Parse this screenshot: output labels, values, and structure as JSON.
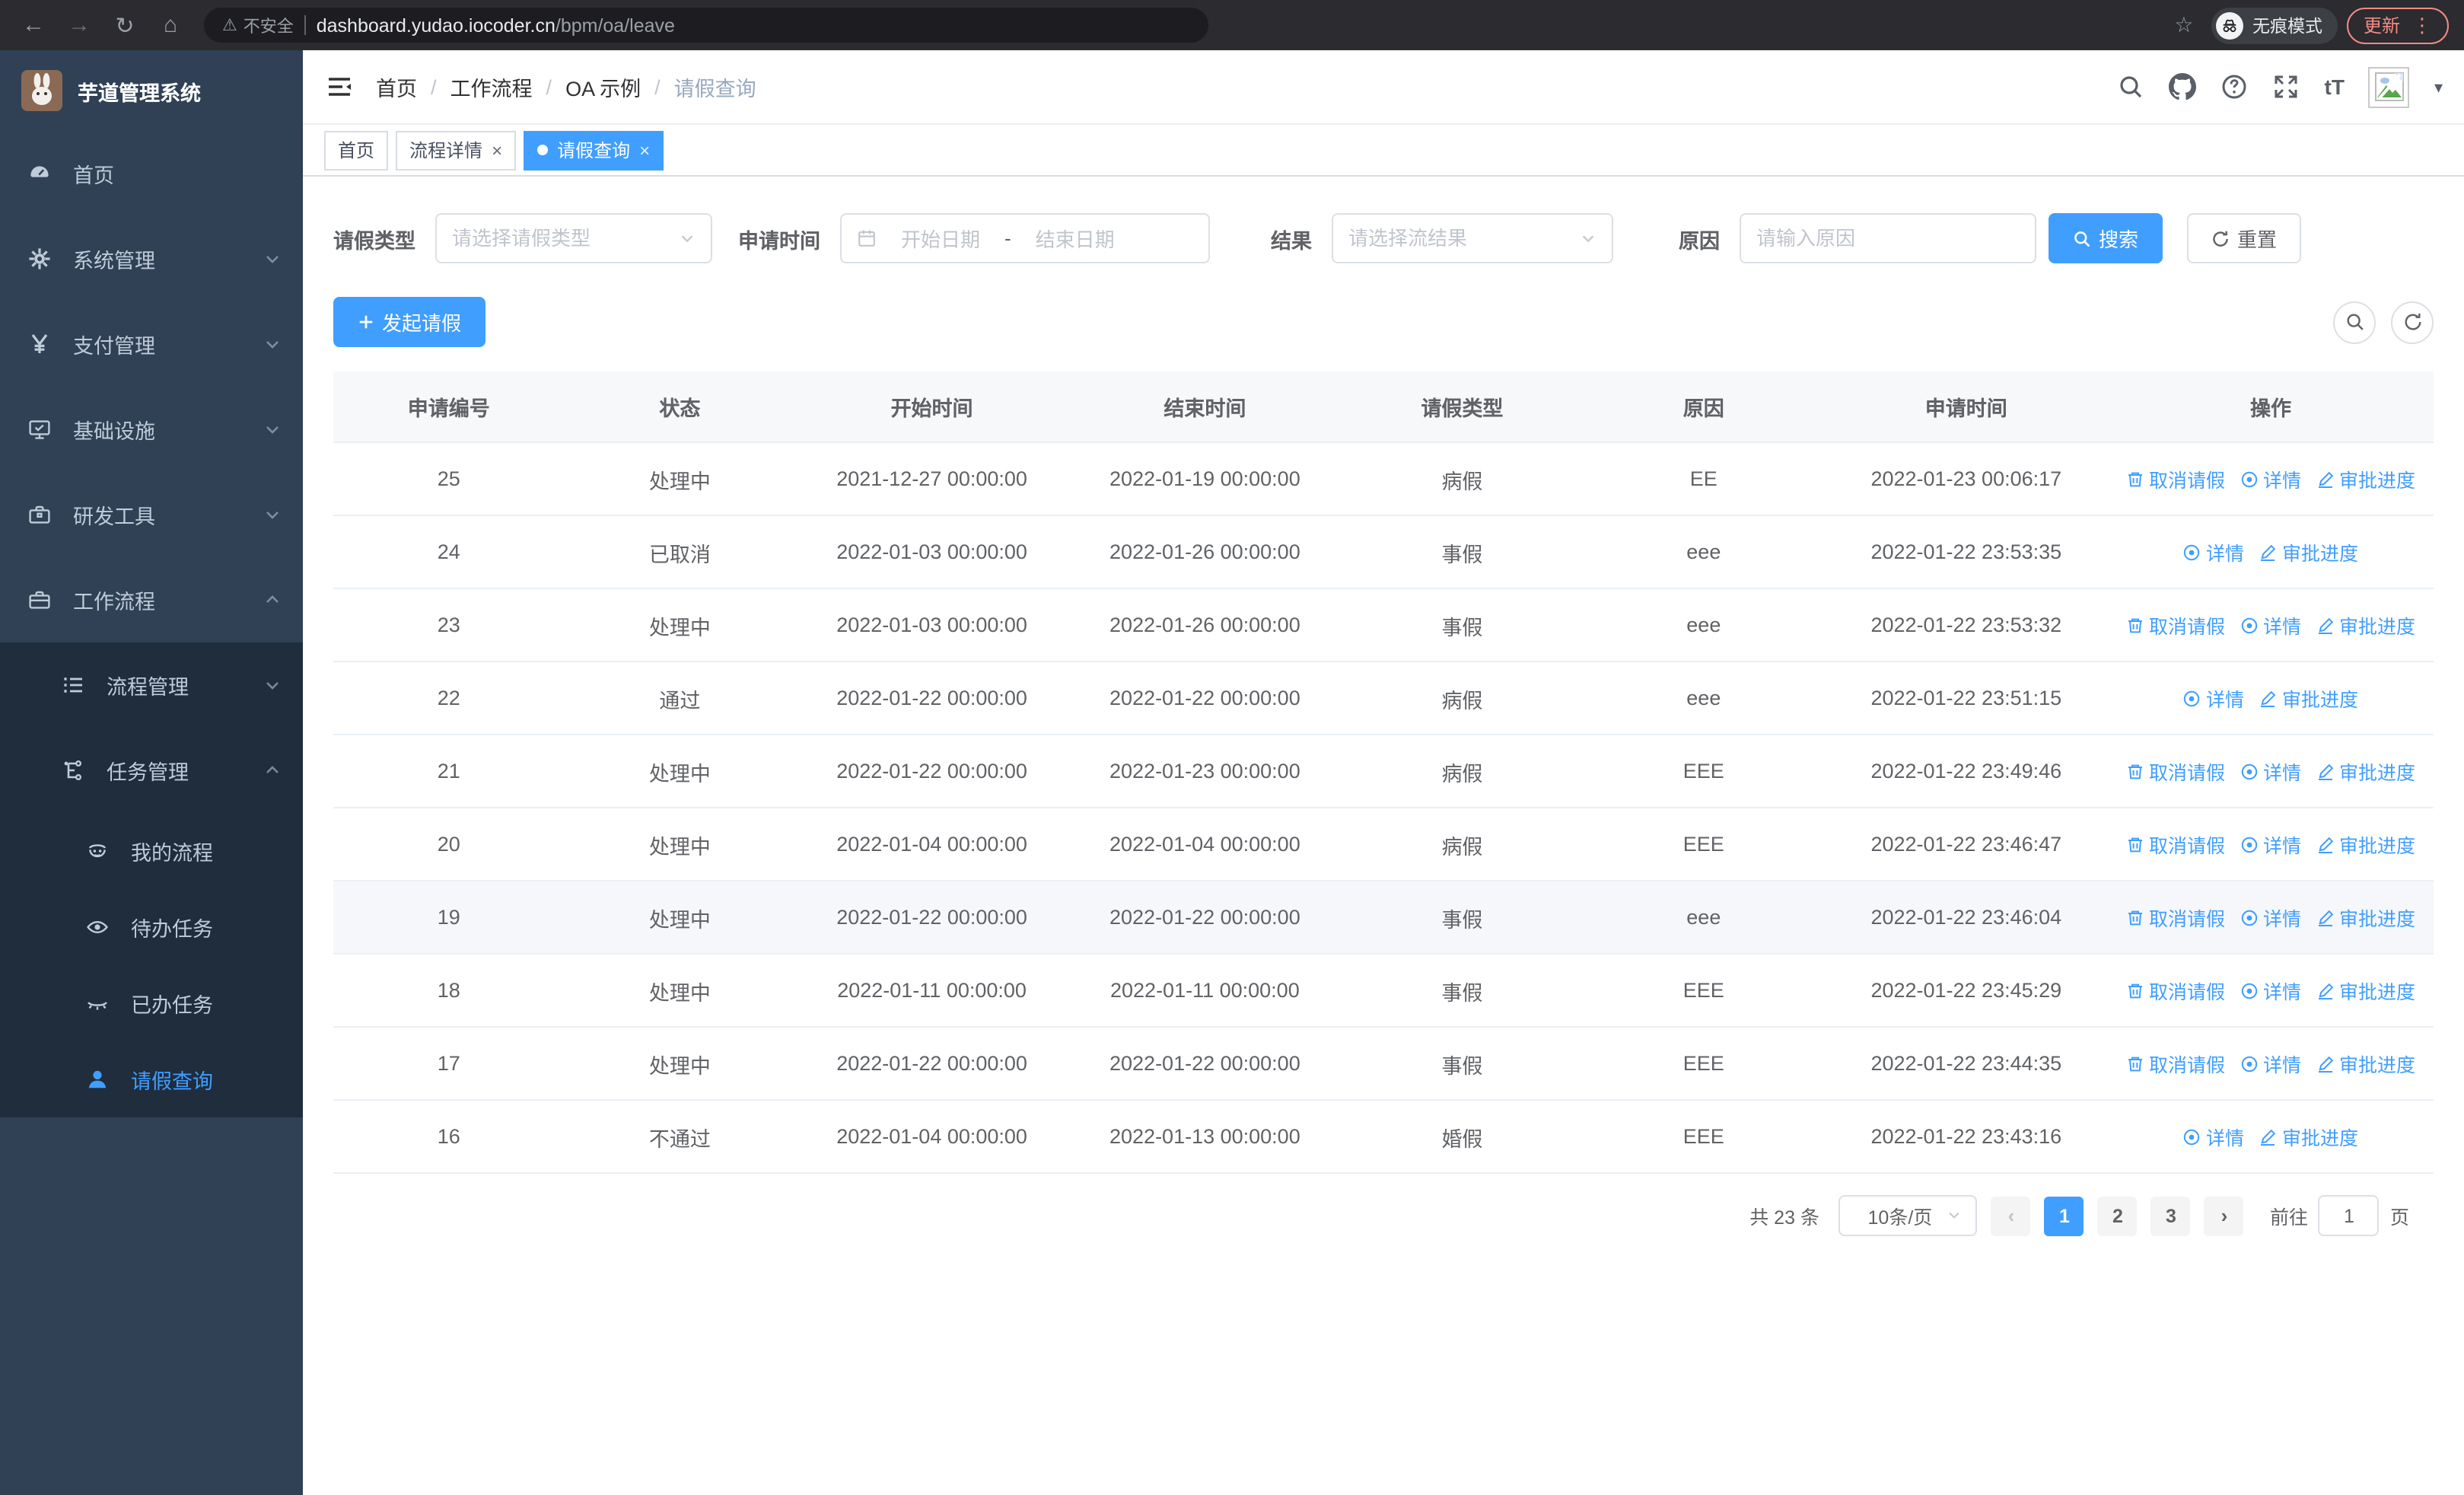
{
  "browser": {
    "security_warning": "不安全",
    "url_host": "dashboard.yudao.iocoder.cn",
    "url_path": "/bpm/oa/leave",
    "incognito_label": "无痕模式",
    "update_label": "更新"
  },
  "sidebar": {
    "title": "芋道管理系统",
    "items": [
      {
        "label": "首页"
      },
      {
        "label": "系统管理"
      },
      {
        "label": "支付管理"
      },
      {
        "label": "基础设施"
      },
      {
        "label": "研发工具"
      },
      {
        "label": "工作流程"
      },
      {
        "label": "流程管理"
      },
      {
        "label": "任务管理"
      },
      {
        "label": "我的流程"
      },
      {
        "label": "待办任务"
      },
      {
        "label": "已办任务"
      },
      {
        "label": "请假查询",
        "active": true
      }
    ]
  },
  "header": {
    "breadcrumb": [
      "首页",
      "工作流程",
      "OA 示例",
      "请假查询"
    ]
  },
  "tabs": {
    "items": [
      {
        "label": "首页",
        "closable": false,
        "active": false
      },
      {
        "label": "流程详情",
        "closable": true,
        "active": false
      },
      {
        "label": "请假查询",
        "closable": true,
        "active": true
      }
    ]
  },
  "filters": {
    "leave_type_label": "请假类型",
    "leave_type_placeholder": "请选择请假类型",
    "apply_time_label": "申请时间",
    "start_date_placeholder": "开始日期",
    "range_separator": "-",
    "end_date_placeholder": "结束日期",
    "result_label": "结果",
    "result_placeholder": "请选择流结果",
    "reason_label": "原因",
    "reason_placeholder": "请输入原因",
    "search_label": "搜索",
    "reset_label": "重置"
  },
  "toolbar": {
    "create_label": "发起请假"
  },
  "table": {
    "columns": [
      "申请编号",
      "状态",
      "开始时间",
      "结束时间",
      "请假类型",
      "原因",
      "申请时间",
      "操作"
    ],
    "action_labels": {
      "cancel": "取消请假",
      "detail": "详情",
      "progress": "审批进度"
    },
    "rows": [
      {
        "id": "25",
        "status": "处理中",
        "start": "2021-12-27 00:00:00",
        "end": "2022-01-19 00:00:00",
        "type": "病假",
        "reason": "EE",
        "applied": "2022-01-23 00:06:17",
        "actions": [
          "cancel",
          "detail",
          "progress"
        ],
        "highlight": false
      },
      {
        "id": "24",
        "status": "已取消",
        "start": "2022-01-03 00:00:00",
        "end": "2022-01-26 00:00:00",
        "type": "事假",
        "reason": "eee",
        "applied": "2022-01-22 23:53:35",
        "actions": [
          "detail",
          "progress"
        ],
        "highlight": false
      },
      {
        "id": "23",
        "status": "处理中",
        "start": "2022-01-03 00:00:00",
        "end": "2022-01-26 00:00:00",
        "type": "事假",
        "reason": "eee",
        "applied": "2022-01-22 23:53:32",
        "actions": [
          "cancel",
          "detail",
          "progress"
        ],
        "highlight": false
      },
      {
        "id": "22",
        "status": "通过",
        "start": "2022-01-22 00:00:00",
        "end": "2022-01-22 00:00:00",
        "type": "病假",
        "reason": "eee",
        "applied": "2022-01-22 23:51:15",
        "actions": [
          "detail",
          "progress"
        ],
        "highlight": false
      },
      {
        "id": "21",
        "status": "处理中",
        "start": "2022-01-22 00:00:00",
        "end": "2022-01-23 00:00:00",
        "type": "病假",
        "reason": "EEE",
        "applied": "2022-01-22 23:49:46",
        "actions": [
          "cancel",
          "detail",
          "progress"
        ],
        "highlight": false
      },
      {
        "id": "20",
        "status": "处理中",
        "start": "2022-01-04 00:00:00",
        "end": "2022-01-04 00:00:00",
        "type": "病假",
        "reason": "EEE",
        "applied": "2022-01-22 23:46:47",
        "actions": [
          "cancel",
          "detail",
          "progress"
        ],
        "highlight": false
      },
      {
        "id": "19",
        "status": "处理中",
        "start": "2022-01-22 00:00:00",
        "end": "2022-01-22 00:00:00",
        "type": "事假",
        "reason": "eee",
        "applied": "2022-01-22 23:46:04",
        "actions": [
          "cancel",
          "detail",
          "progress"
        ],
        "highlight": true
      },
      {
        "id": "18",
        "status": "处理中",
        "start": "2022-01-11 00:00:00",
        "end": "2022-01-11 00:00:00",
        "type": "事假",
        "reason": "EEE",
        "applied": "2022-01-22 23:45:29",
        "actions": [
          "cancel",
          "detail",
          "progress"
        ],
        "highlight": false
      },
      {
        "id": "17",
        "status": "处理中",
        "start": "2022-01-22 00:00:00",
        "end": "2022-01-22 00:00:00",
        "type": "事假",
        "reason": "EEE",
        "applied": "2022-01-22 23:44:35",
        "actions": [
          "cancel",
          "detail",
          "progress"
        ],
        "highlight": false
      },
      {
        "id": "16",
        "status": "不通过",
        "start": "2022-01-04 00:00:00",
        "end": "2022-01-13 00:00:00",
        "type": "婚假",
        "reason": "EEE",
        "applied": "2022-01-22 23:43:16",
        "actions": [
          "detail",
          "progress"
        ],
        "highlight": false
      }
    ]
  },
  "pagination": {
    "total_label": "共 23 条",
    "page_size": "10条/页",
    "pages": [
      "1",
      "2",
      "3"
    ],
    "active_page": "1",
    "goto_label": "前往",
    "goto_value": "1",
    "unit_label": "页"
  },
  "colors": {
    "accent": "#409eff",
    "sidebar_bg": "#304156",
    "submenu_bg": "#1f2d3d",
    "sidebar_text": "#bfcbd9",
    "update_accent": "#f28b82",
    "row_highlight": "#f5f7fa",
    "table_border": "#ebeef5"
  }
}
